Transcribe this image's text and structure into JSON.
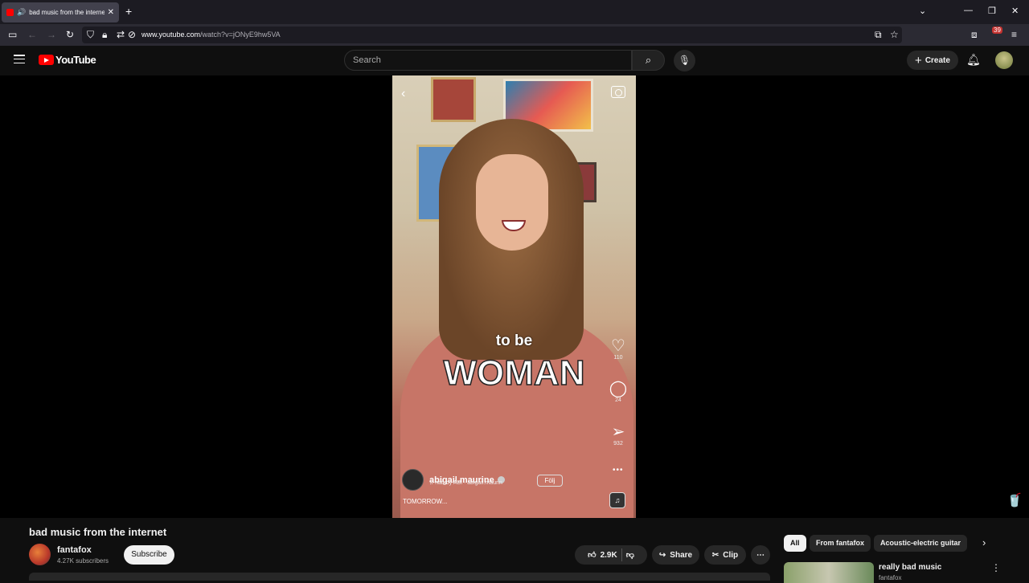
{
  "browser": {
    "tab_title": "bad music from the internet",
    "url_domain": "www.youtube.com",
    "url_path": "/watch?v=jONyE9hw5VA",
    "extension_badge": "39"
  },
  "header": {
    "logo_text": "YouTube",
    "search_placeholder": "Search",
    "create_label": "Create"
  },
  "video": {
    "caption_small": "to be",
    "caption_big": "WOMAN",
    "likes": "110",
    "comments": "24",
    "shares": "932",
    "ig_username": "abigail.maurine",
    "ig_audio": "nan by ABI · abigail.maurin",
    "ig_follow": "Följ",
    "ig_song": "TOMORROW..."
  },
  "info": {
    "title": "bad music from the internet",
    "channel": "fantafox",
    "subscribers": "4.27K subscribers",
    "subscribe_label": "Subscribe",
    "like_count": "2.9K",
    "share_label": "Share",
    "clip_label": "Clip"
  },
  "chips": [
    {
      "label": "All"
    },
    {
      "label": "From fantafox"
    },
    {
      "label": "Acoustic-electric guitar"
    }
  ],
  "recommendation": {
    "title": "really bad music",
    "channel": "fantafox"
  },
  "colors": {
    "yt_red": "#ff0000",
    "background": "#0f0f0f",
    "pill": "#272727"
  }
}
